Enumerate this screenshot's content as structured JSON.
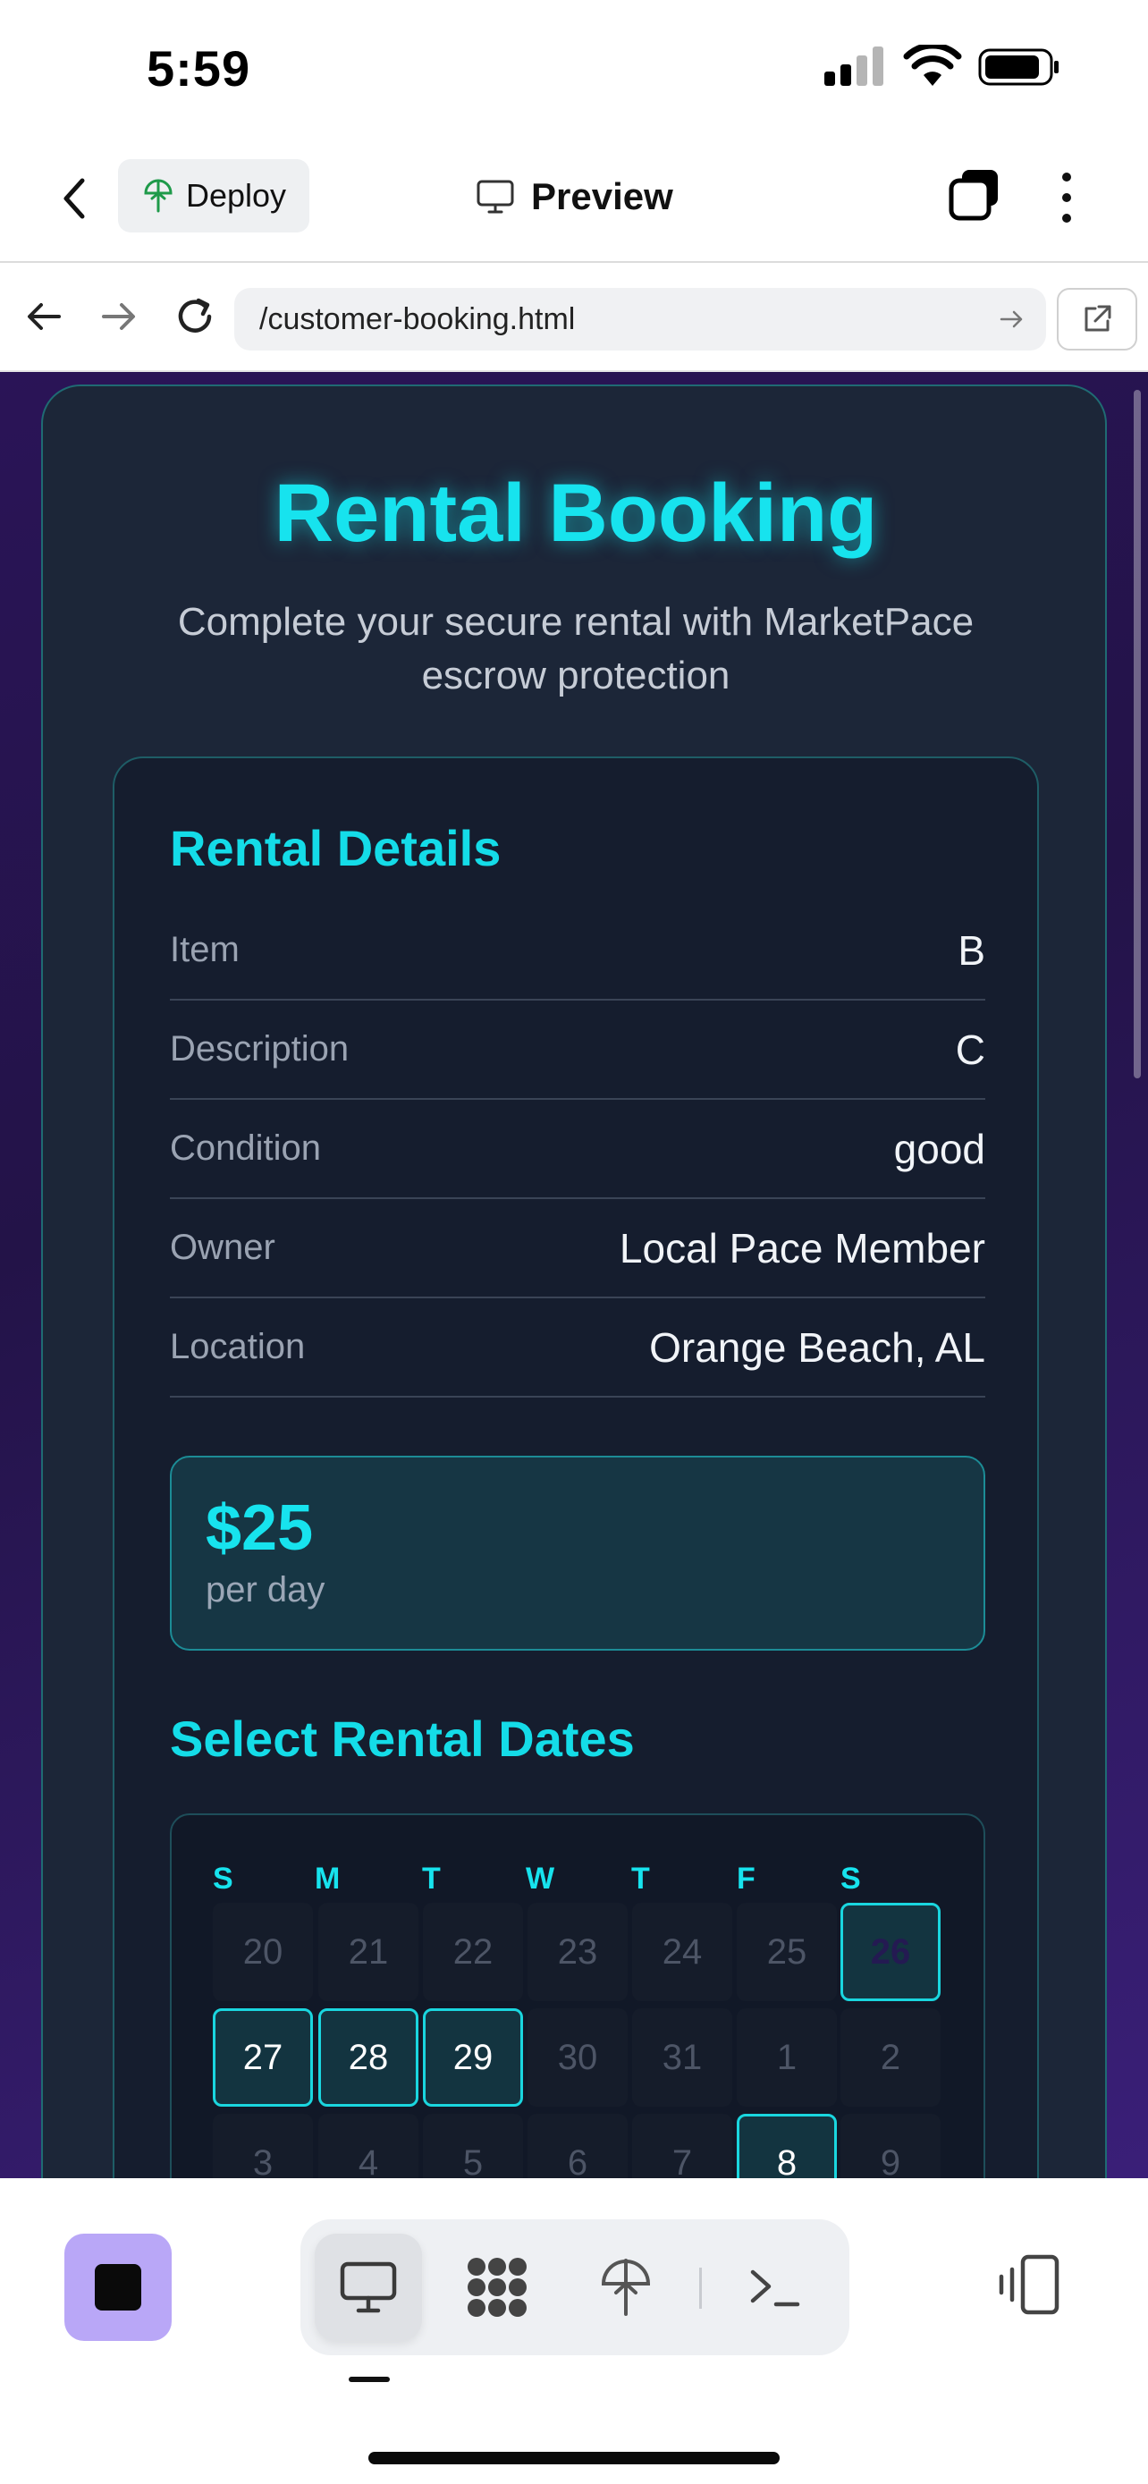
{
  "status_bar": {
    "time": "5:59"
  },
  "toolbar": {
    "deploy_label": "Deploy",
    "preview_label": "Preview"
  },
  "browser": {
    "url": "/customer-booking.html"
  },
  "page": {
    "title": "Rental Booking",
    "subtitle": "Complete your secure rental with MarketPace escrow protection",
    "details_title": "Rental Details",
    "details": [
      {
        "label": "Item",
        "value": "B"
      },
      {
        "label": "Description",
        "value": "C"
      },
      {
        "label": "Condition",
        "value": "good"
      },
      {
        "label": "Owner",
        "value": "Local Pace Member"
      },
      {
        "label": "Location",
        "value": "Orange Beach, AL"
      }
    ],
    "price": {
      "amount": "$25",
      "unit": "per day"
    },
    "dates_title": "Select Rental Dates",
    "calendar": {
      "weekdays": [
        "S",
        "M",
        "T",
        "W",
        "T",
        "F",
        "S"
      ],
      "rows": [
        [
          "20",
          "21",
          "22",
          "23",
          "24",
          "25",
          "26"
        ],
        [
          "27",
          "28",
          "29",
          "30",
          "31",
          "1",
          "2"
        ],
        [
          "3",
          "4",
          "5",
          "6",
          "7",
          "8",
          "9"
        ]
      ]
    }
  },
  "colors": {
    "accent": "#17e3ee",
    "card_bg": "#1c2638",
    "page_bg": "#2a1457",
    "stop_button": "#b9a7f7"
  },
  "icons": [
    "back-chevron-icon",
    "deploy-icon",
    "monitor-icon",
    "tabs-icon",
    "more-vertical-icon",
    "arrow-left-icon",
    "arrow-right-icon",
    "reload-icon",
    "go-arrow-icon",
    "external-link-icon",
    "stop-icon",
    "desktop-icon",
    "grid-icon",
    "deploy-icon",
    "terminal-icon",
    "device-toggle-icon"
  ]
}
